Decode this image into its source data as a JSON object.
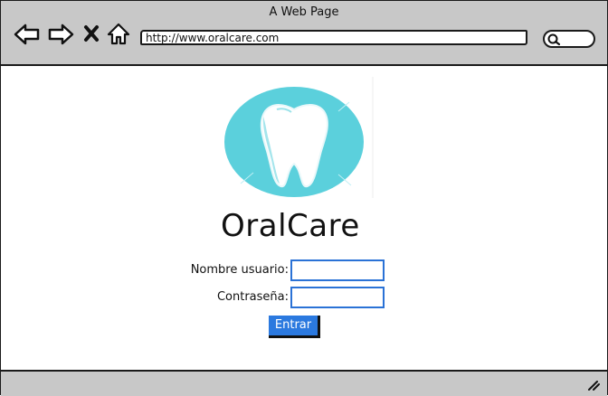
{
  "browser": {
    "title": "A Web Page",
    "url": "http://www.oralcare.com",
    "icons": [
      "back-arrow-icon",
      "forward-arrow-icon",
      "close-x-icon",
      "home-icon",
      "search-icon",
      "resize-grip-icon"
    ]
  },
  "page": {
    "logo_text": "OralCare",
    "logo_icon": "tooth-icon",
    "brand_color": "#5bd0dc",
    "form": {
      "username_label": "Nombre usuario:",
      "username_value": "",
      "password_label": "Contraseña:",
      "password_value": "",
      "submit_label": "Entrar"
    }
  },
  "colors": {
    "chrome": "#c8c8c8",
    "accent": "#2b79df"
  }
}
